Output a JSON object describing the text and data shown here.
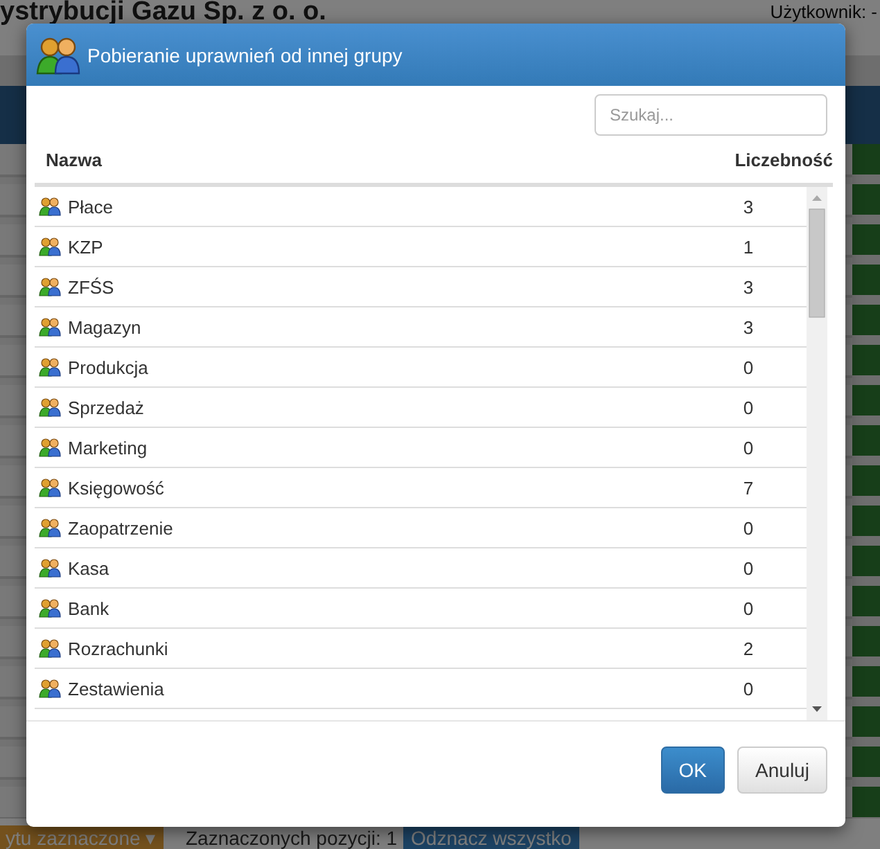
{
  "background": {
    "company": "ystrybucji Gazu Sp. z o. o.",
    "user_label": "Użytkownik: -",
    "bulk_action": "ytu zaznaczone ▾",
    "selected_count": "Zaznaczonych pozycji: 1",
    "deselect_all": "Odznacz wszystko"
  },
  "dialog": {
    "title": "Pobieranie uprawnień od innej grupy",
    "search": {
      "placeholder": "Szukaj..."
    },
    "columns": [
      "Nazwa",
      "Liczebność"
    ],
    "rows": [
      {
        "name": "Płace",
        "count": "3"
      },
      {
        "name": "KZP",
        "count": "1"
      },
      {
        "name": "ZFŚS",
        "count": "3"
      },
      {
        "name": "Magazyn",
        "count": "3"
      },
      {
        "name": "Produkcja",
        "count": "0"
      },
      {
        "name": "Sprzedaż",
        "count": "0"
      },
      {
        "name": "Marketing",
        "count": "0"
      },
      {
        "name": "Księgowość",
        "count": "7"
      },
      {
        "name": "Zaopatrzenie",
        "count": "0"
      },
      {
        "name": "Kasa",
        "count": "0"
      },
      {
        "name": "Bank",
        "count": "0"
      },
      {
        "name": "Rozrachunki",
        "count": "2"
      },
      {
        "name": "Zestawienia",
        "count": "0"
      }
    ],
    "buttons": [
      {
        "label": "OK",
        "kind": "primary"
      },
      {
        "label": "Anuluj",
        "kind": "default"
      }
    ]
  }
}
